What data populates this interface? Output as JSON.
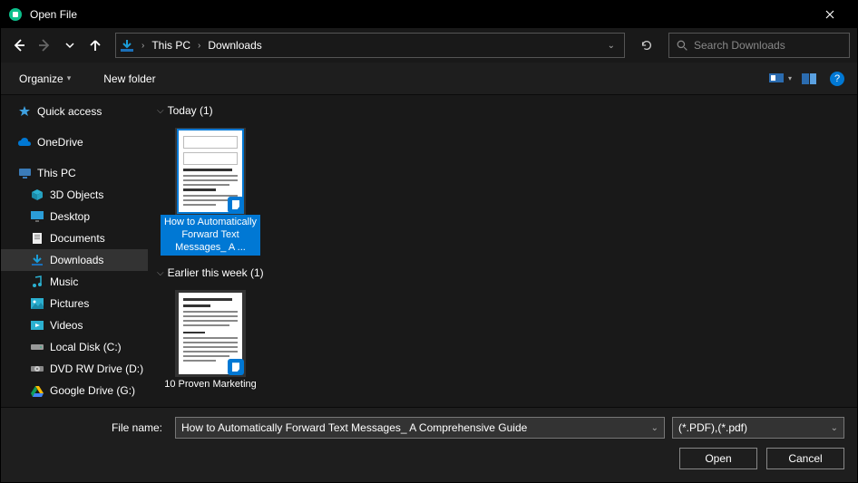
{
  "window": {
    "title": "Open File"
  },
  "nav": {
    "path": {
      "root": "This PC",
      "folder": "Downloads"
    }
  },
  "search": {
    "placeholder": "Search Downloads"
  },
  "toolbar": {
    "organize": "Organize",
    "new_folder": "New folder"
  },
  "sidebar": {
    "quick_access": "Quick access",
    "onedrive": "OneDrive",
    "this_pc": "This PC",
    "items": {
      "objects3d": "3D Objects",
      "desktop": "Desktop",
      "documents": "Documents",
      "downloads": "Downloads",
      "music": "Music",
      "pictures": "Pictures",
      "videos": "Videos",
      "localdisk": "Local Disk (C:)",
      "dvd": "DVD RW Drive (D:)",
      "gdrive": "Google Drive (G:)"
    }
  },
  "groups": [
    {
      "label": "Today (1)",
      "files": [
        {
          "caption": "How to Automatically Forward Text Messages_ A ...",
          "selected": true
        }
      ]
    },
    {
      "label": "Earlier this week (1)",
      "files": [
        {
          "caption": "10 Proven Marketing",
          "selected": false
        }
      ]
    }
  ],
  "footer": {
    "filename_label": "File name:",
    "filename_value": "How to Automatically Forward Text Messages_ A Comprehensive Guide",
    "filter": "(*.PDF),(*.pdf)",
    "open": "Open",
    "cancel": "Cancel"
  }
}
